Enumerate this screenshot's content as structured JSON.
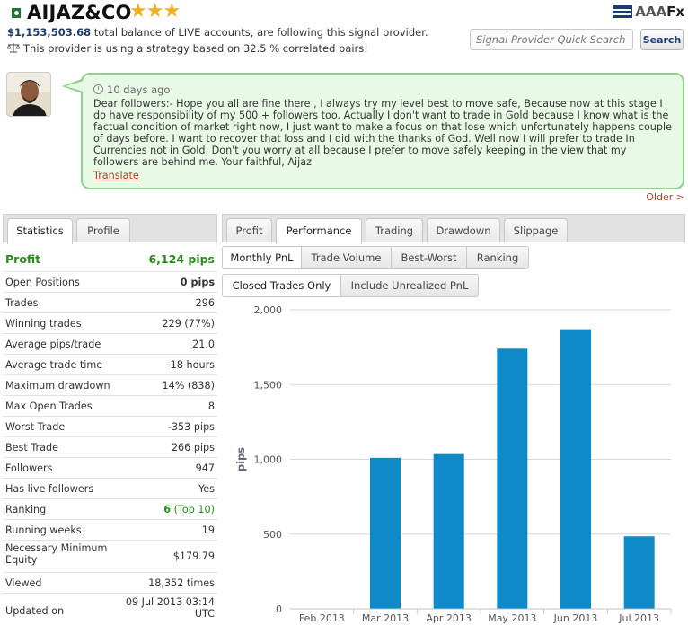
{
  "header": {
    "title": "AIJAZ&CO",
    "stars": "★★★",
    "balance_amount": "$1,153,503.68",
    "balance_text": " total balance of LIVE accounts, are following this signal provider.",
    "strategy_text": "This provider is using a strategy based on 32.5 % correlated pairs!",
    "logo_text": "AAA",
    "logo_fx": "Fx",
    "search_placeholder": "Signal Provider Quick Search",
    "search_button": "Search"
  },
  "post": {
    "time": "10 days ago",
    "message": "Dear followers:- Hope you all are fine there , I always try my level best to move safe, Because now at this stage I do have responsibility of my 500 + followers too. Actually I don't want to trade in Gold because I know what is the factual condition of market right now, I just want to make a focus on that lose which unfortunately happens couple of days before. I want to recover that loss and I did with the thanks of God. Well now I will prefer to trade In Currencies not in Gold. Don't you worry at all because I prefer to move safely keeping in the view that my followers are behind me. Your faithful, Aijaz",
    "translate": "Translate",
    "older": "Older >"
  },
  "left_tabs": [
    "Statistics",
    "Profile"
  ],
  "stats": [
    {
      "label": "Profit",
      "value": "6,124 pips"
    },
    {
      "label": "Open Positions",
      "value": "0 pips"
    },
    {
      "label": "Trades",
      "value": "296"
    },
    {
      "label": "Winning trades",
      "value": "229 (77%)"
    },
    {
      "label": "Average pips/trade",
      "value": "21.0"
    },
    {
      "label": "Average trade time",
      "value": "18 hours"
    },
    {
      "label": "Maximum drawdown",
      "value": "14% (838)"
    },
    {
      "label": "Max Open Trades",
      "value": "8"
    },
    {
      "label": "Worst Trade",
      "value": "-353 pips"
    },
    {
      "label": "Best Trade",
      "value": "266 pips"
    },
    {
      "label": "Followers",
      "value": "947"
    },
    {
      "label": "Has live followers",
      "value": "Yes"
    },
    {
      "label": "Ranking",
      "value_main": "6",
      "value_extra": "(Top 10)"
    },
    {
      "label": "Running weeks",
      "value": "19"
    },
    {
      "label": "Necessary Minimum Equity",
      "label_line1": "Necessary Minimum",
      "label_line2": "Equity",
      "value": "$179.79"
    },
    {
      "label": "Viewed",
      "value": "18,352 times"
    },
    {
      "label": "Updated on",
      "value_line1": "09 Jul 2013 03:14",
      "value_line2": "UTC"
    }
  ],
  "right_tabs": [
    "Profit",
    "Performance",
    "Trading",
    "Drawdown",
    "Slippage"
  ],
  "perf_tabs": [
    "Monthly PnL",
    "Trade Volume",
    "Best-Worst",
    "Ranking"
  ],
  "filter_tabs": [
    "Closed Trades Only",
    "Include Unrealized PnL"
  ],
  "colors": {
    "bar": "#0e8ac8",
    "profit_green": "#2a8a1c",
    "bubble_bg": "#e8fae6",
    "bubble_border": "#8fd08f",
    "link": "#b0402a"
  },
  "chart_data": {
    "type": "bar",
    "categories": [
      "Feb 2013",
      "Mar 2013",
      "Apr 2013",
      "May 2013",
      "Jun 2013",
      "Jul 2013"
    ],
    "values": [
      0,
      1010,
      1035,
      1740,
      1870,
      485
    ],
    "ylabel": "pips",
    "ylim": [
      0,
      2000
    ],
    "yticks": [
      0,
      500,
      1000,
      1500,
      2000
    ],
    "ytick_labels": [
      "0",
      "500",
      "1,000",
      "1,500",
      "2,000"
    ],
    "grid": true
  }
}
